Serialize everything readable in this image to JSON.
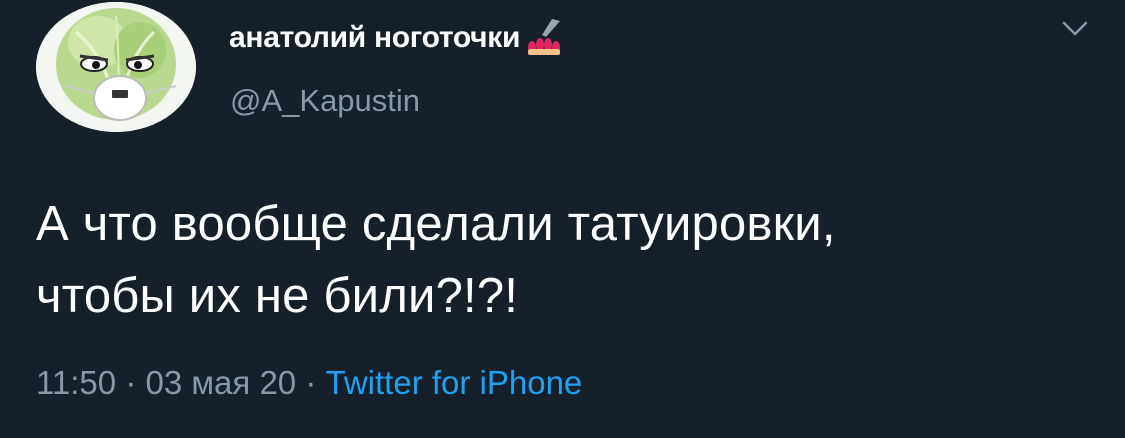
{
  "author": {
    "display_name": "анатолий ноготочки",
    "handle": "@A_Kapustin",
    "name_emoji": "nail-polish-icon",
    "avatar": "cabbage-with-respirator-avatar"
  },
  "tweet": {
    "text_lines": [
      "А что вообще сделали татуировки,",
      "чтобы их не били?!?!"
    ]
  },
  "meta": {
    "time": "11:50",
    "separator": "·",
    "date": "03 мая 20",
    "source": "Twitter for iPhone"
  },
  "menu": {
    "icon": "chevron-down-icon"
  },
  "colors": {
    "background": "#15202b",
    "text": "#ffffff",
    "secondary_text": "#8899a6",
    "link": "#1da1f2"
  }
}
